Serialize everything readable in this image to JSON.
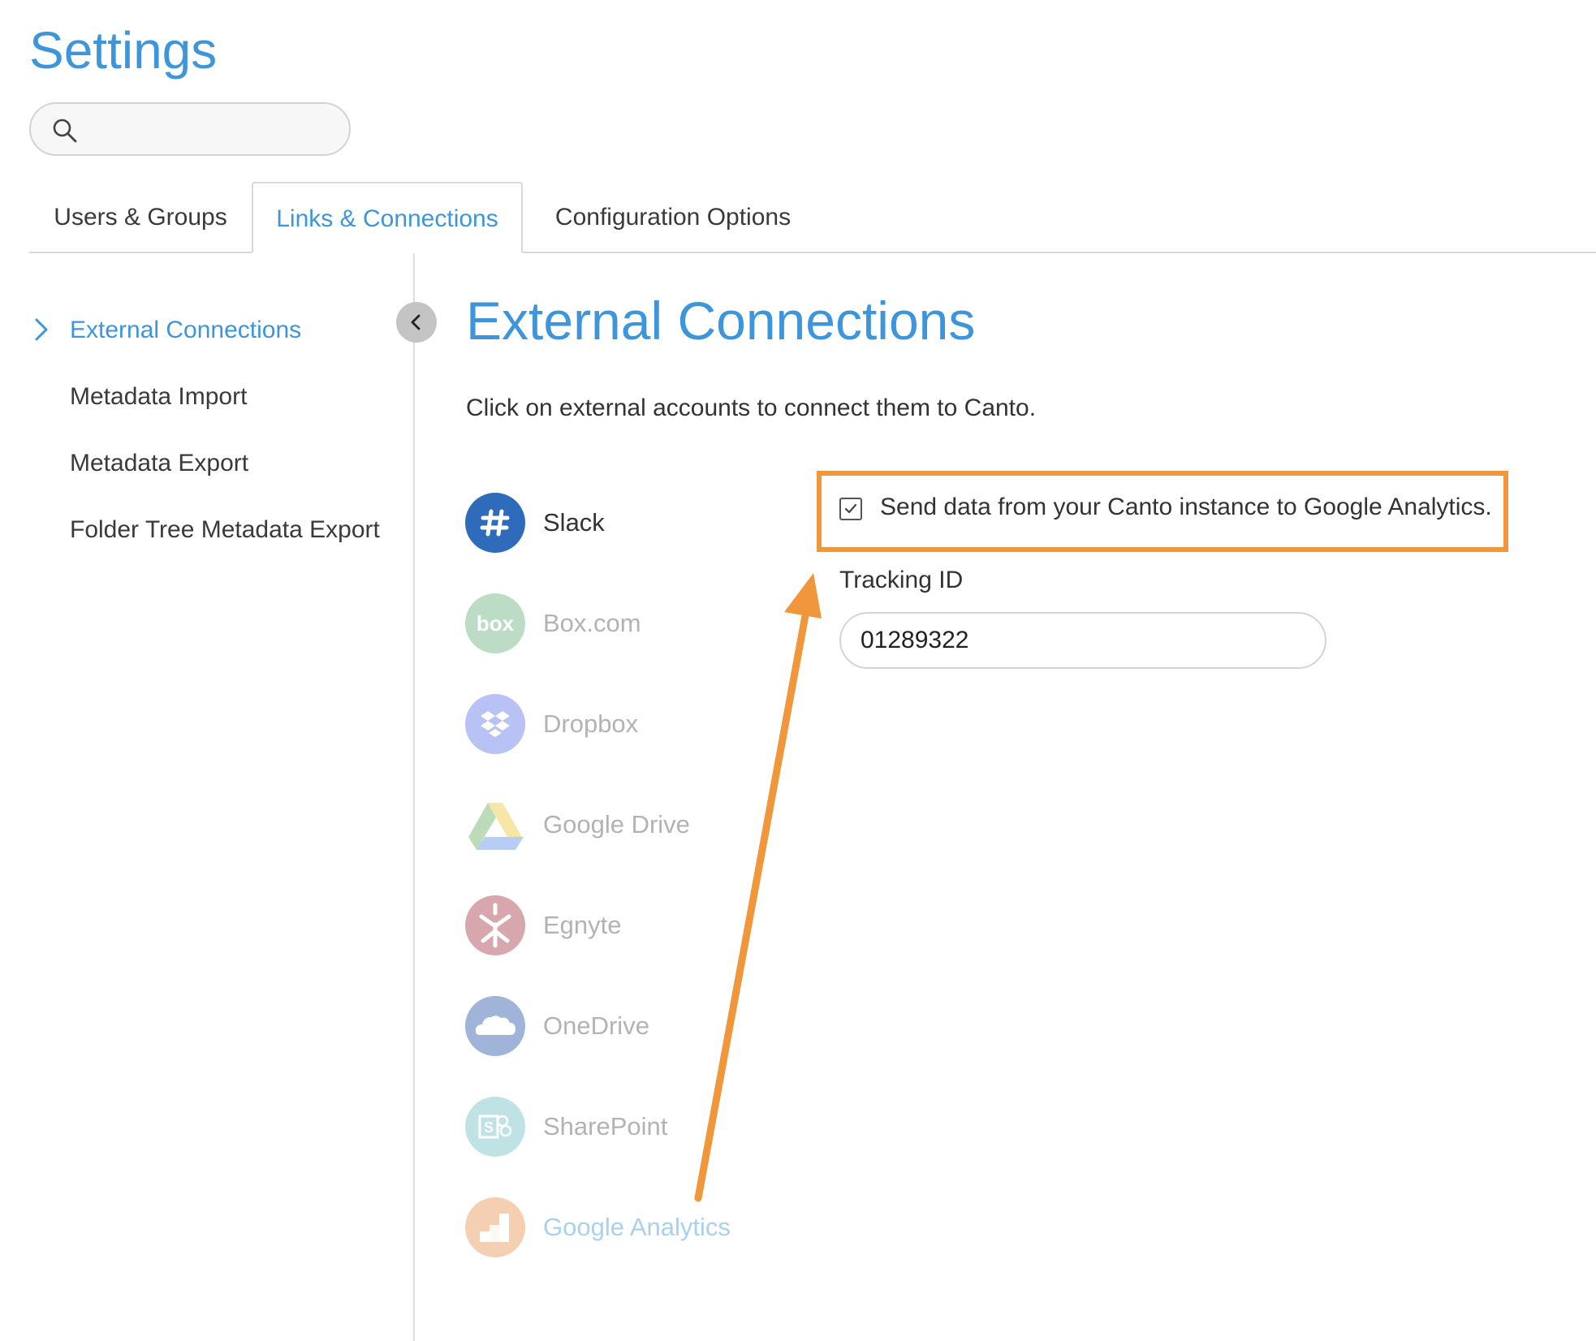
{
  "page_title": "Settings",
  "search": {
    "value": "",
    "placeholder": ""
  },
  "tabs": [
    {
      "label": "Users & Groups",
      "active": false
    },
    {
      "label": "Links & Connections",
      "active": true
    },
    {
      "label": "Configuration Options",
      "active": false
    }
  ],
  "sidebar": {
    "items": [
      {
        "label": "External Connections",
        "active": true
      },
      {
        "label": "Metadata Import",
        "active": false
      },
      {
        "label": "Metadata Export",
        "active": false
      },
      {
        "label": "Folder Tree Metadata Export",
        "active": false
      }
    ]
  },
  "main": {
    "title": "External Connections",
    "instructions": "Click on external accounts to connect them to Canto.",
    "connections": [
      {
        "name": "Slack",
        "icon": "slack-icon",
        "color": "#2e6bbb",
        "state": "connected"
      },
      {
        "name": "Box.com",
        "icon": "box-icon",
        "color": "#bcdcc6",
        "state": "disabled"
      },
      {
        "name": "Dropbox",
        "icon": "dropbox-icon",
        "color": "#b9c2f5",
        "state": "disabled"
      },
      {
        "name": "Google Drive",
        "icon": "google-drive-icon",
        "color": "#d6e2cf",
        "state": "disabled"
      },
      {
        "name": "Egnyte",
        "icon": "egnyte-icon",
        "color": "#d8a7ae",
        "state": "disabled"
      },
      {
        "name": "OneDrive",
        "icon": "onedrive-icon",
        "color": "#9fb4d8",
        "state": "disabled"
      },
      {
        "name": "SharePoint",
        "icon": "sharepoint-icon",
        "color": "#bfe3e5",
        "state": "disabled"
      },
      {
        "name": "Google Analytics",
        "icon": "google-analytics-icon",
        "color": "#f5cfb1",
        "state": "selected"
      }
    ],
    "analytics": {
      "checkbox_label": "Send data from your Canto instance to Google Analytics.",
      "checked": true,
      "tracking_label": "Tracking ID",
      "tracking_value": "01289322"
    }
  },
  "colors": {
    "accent": "#3d96db",
    "highlight": "#f0973b",
    "disabled_text": "#b3b3b3",
    "selected_text": "#a9d1ef"
  }
}
